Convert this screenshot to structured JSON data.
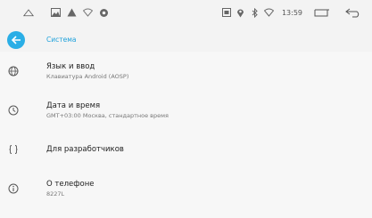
{
  "toolbar": {
    "title": "Система"
  },
  "status": {
    "time": "13:59"
  },
  "items": [
    {
      "title": "Язык и ввод",
      "summary": "Клавиатура Android (AOSP)",
      "icon": "globe-icon"
    },
    {
      "title": "Дата и время",
      "summary": "GMT+03:00 Москва, стандартное время",
      "icon": "clock-icon"
    },
    {
      "title": "Для разработчиков",
      "summary": "",
      "icon": "braces-icon"
    },
    {
      "title": "О телефоне",
      "summary": "8227L",
      "icon": "info-icon"
    }
  ],
  "colors": {
    "accent": "#2aaee6",
    "accent_text": "#1da1db",
    "background": "#f7f7f7"
  }
}
